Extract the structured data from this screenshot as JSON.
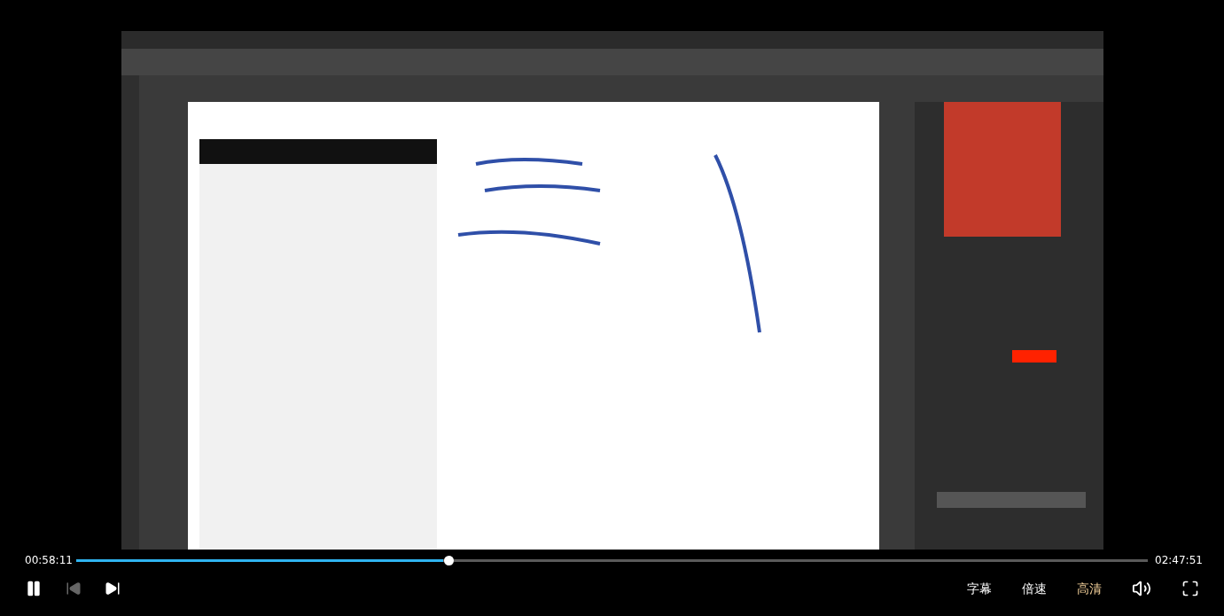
{
  "controls": {
    "elapsed": "00:58:11",
    "duration": "02:47:51",
    "progress": {
      "level": 0.347
    },
    "playing": true,
    "previous": {
      "disabled": true
    },
    "options": [
      {
        "label": "字幕",
        "selected": false
      },
      {
        "label": "倍速",
        "selected": false
      },
      {
        "label": "高清",
        "selected": true
      }
    ]
  }
}
